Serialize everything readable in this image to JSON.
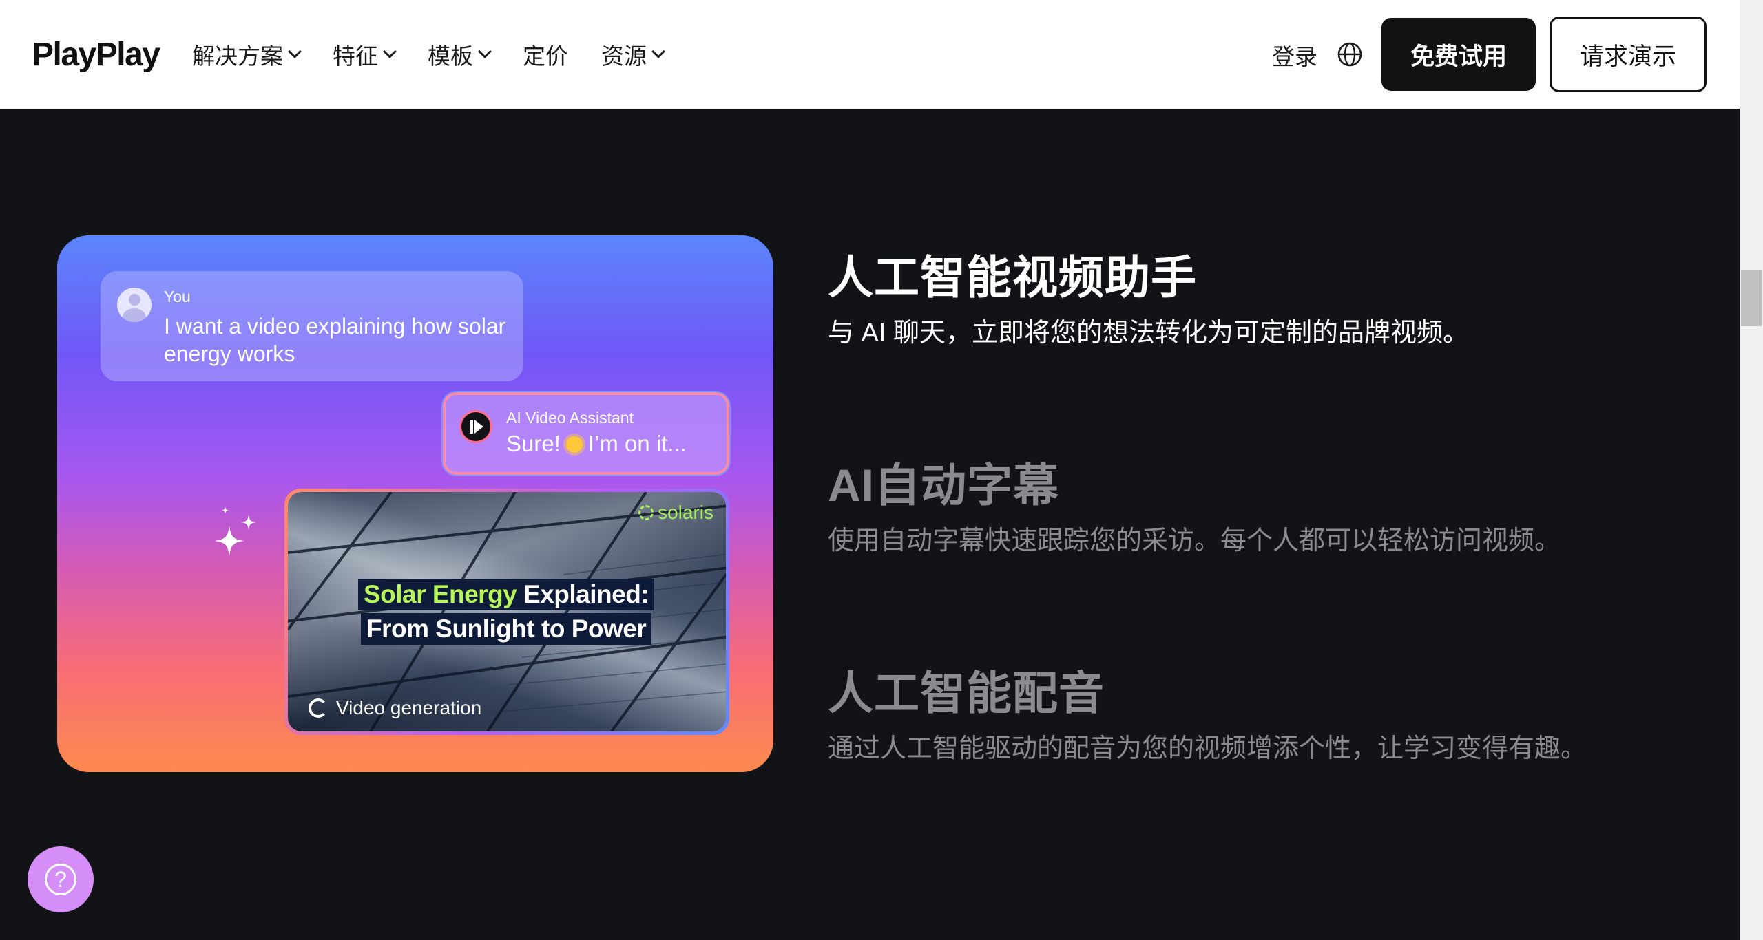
{
  "header": {
    "logo": "PlayPlay",
    "nav": [
      {
        "label": "解决方案",
        "has_dropdown": true
      },
      {
        "label": "特征",
        "has_dropdown": true
      },
      {
        "label": "模板",
        "has_dropdown": true
      },
      {
        "label": "定价",
        "has_dropdown": false
      },
      {
        "label": "资源",
        "has_dropdown": true
      }
    ],
    "login": "登录",
    "language_icon": "globe-icon",
    "trial_button": "免费试用",
    "demo_button": "请求演示"
  },
  "card": {
    "user_name": "You",
    "user_message": "I want a video explaining how solar energy works",
    "assistant_name": "AI Video Assistant",
    "assistant_message_a": "Sure!",
    "assistant_message_b": "I’m on it...",
    "brand": "solaris",
    "video_title_highlight": "Solar Energy",
    "video_title_rest": " Explained:",
    "video_title_line2": "From Sunlight to Power",
    "status": "Video generation"
  },
  "features": [
    {
      "title": "人工智能视频助手",
      "description": "与 AI 聊天，立即将您的想法转化为可定制的品牌视频。",
      "active": true
    },
    {
      "title": "AI自动字幕",
      "description": "使用自动字幕快速跟踪您的采访。每个人都可以轻松访问视频。",
      "active": false
    },
    {
      "title": "人工智能配音",
      "description": "通过人工智能驱动的配音为您的视频增添个性，让学习变得有趣。",
      "active": false
    }
  ],
  "help": {
    "label": "?"
  },
  "colors": {
    "background": "#121316",
    "header_bg": "#ffffff",
    "primary_button": "#111214",
    "highlight_green": "#b7f55a",
    "help_button": "#d58ef8",
    "inactive_text": "#8a8b8e"
  }
}
